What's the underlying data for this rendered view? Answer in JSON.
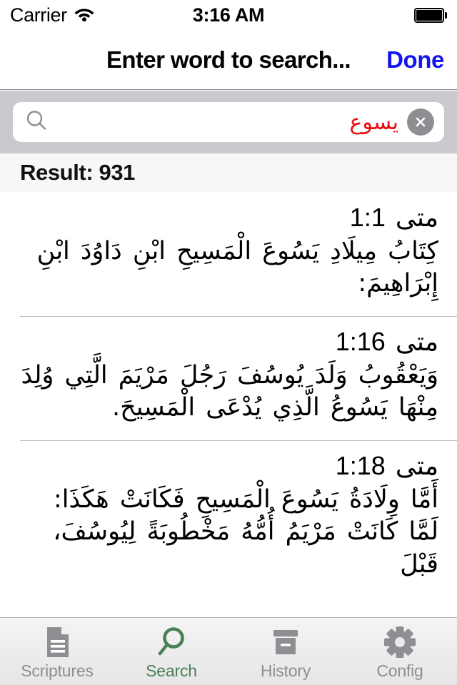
{
  "status_bar": {
    "carrier": "Carrier",
    "wifi_icon": "wifi-icon",
    "time": "3:16 AM",
    "battery_icon": "battery-icon"
  },
  "nav_bar": {
    "title": "Enter word to search...",
    "done_label": "Done",
    "done_color": "#1414f0"
  },
  "search": {
    "icon": "search-glass-icon",
    "value": "يسوع",
    "placeholder": "Enter word to search...",
    "value_color": "#e51010",
    "clear_icon": "clear-circle-icon",
    "bar_background": "#c9c9cf"
  },
  "section_header": {
    "label": "Result: 931",
    "count": 931
  },
  "results": [
    {
      "book": "متى",
      "reference": "1:1",
      "text": "كِتَابُ مِيلَادِ يَسُوعَ الْمَسِيحِ ابْنِ دَاوُدَ ابْنِ إِبْرَاهِيمَ:"
    },
    {
      "book": "متى",
      "reference": "1:16",
      "text": "وَيَعْقُوبُ وَلَدَ يُوسُفَ رَجُلَ مَرْيَمَ الَّتِي وُلِدَ مِنْهَا يَسُوعُ الَّذِي يُدْعَى الْمَسِيحَ."
    },
    {
      "book": "متى",
      "reference": "1:18",
      "text": "أَمَّا وِلَادَةُ يَسُوعَ الْمَسِيحِ فَكَانَتْ هَكَذَا: لَمَّا كَانَتْ مَرْيَمُ أُمُّهُ مَخْطُوبَةً لِيُوسُفَ، قَبْلَ"
    }
  ],
  "tab_bar": {
    "active_color": "#4a8055",
    "inactive_color": "#8e8e93",
    "tabs": [
      {
        "label": "Scriptures",
        "icon": "document-icon",
        "active": false
      },
      {
        "label": "Search",
        "icon": "search-icon",
        "active": true
      },
      {
        "label": "History",
        "icon": "archive-box-icon",
        "active": false
      },
      {
        "label": "Config",
        "icon": "gear-icon",
        "active": false
      }
    ]
  }
}
